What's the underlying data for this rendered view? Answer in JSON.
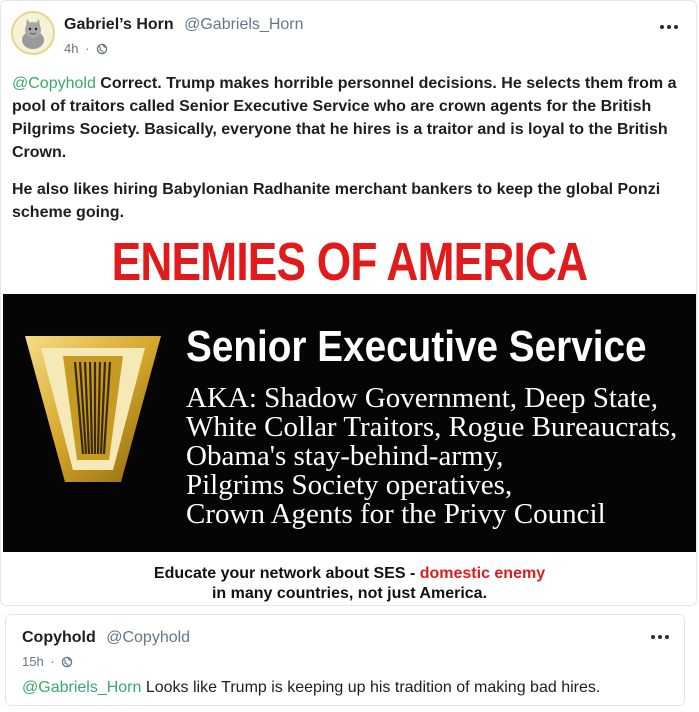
{
  "post": {
    "display_name": "Gabriel’s Horn",
    "handle": "@Gabriels_Horn",
    "time": "4h",
    "separator": "·",
    "mention": "@Copyhold",
    "paragraph1_rest": " Correct. Trump makes horrible personnel decisions. He selects them from a pool of traitors called Senior Executive Service who are crown agents for the British Pilgrims Society. Basically, everyone that he hires is a traitor and is loyal to the British Crown.",
    "paragraph2": "He also likes hiring Babylonian Radhanite merchant bankers to keep the global Ponzi scheme going.",
    "image": {
      "headline": "ENEMIES OF AMERICA",
      "title": "Senior Executive Service",
      "aka_lines": [
        "AKA: Shadow Government, Deep State,",
        "White Collar Traitors, Rogue Bureaucrats,",
        "Obama's stay-behind-army,",
        "Pilgrims Society operatives,",
        "Crown Agents for the Privy Council"
      ],
      "footer_line1_prefix": "Educate your network about SES - ",
      "footer_line1_red": "domestic enemy",
      "footer_line2": "in many countries, not just America.",
      "colors": {
        "headline": "#e11b1b",
        "band": "#050505",
        "emblem_gold": "#d4a62a"
      }
    },
    "icons": {
      "avatar": "cat-avatar-icon",
      "visibility": "globe-icon",
      "menu": "more-options-icon"
    }
  },
  "reply": {
    "display_name": "Copyhold",
    "handle": "@Copyhold",
    "time": "15h",
    "separator": "·",
    "mention": "@Gabriels_Horn",
    "text_rest": " Looks like Trump is keeping up his tradition of making bad hires."
  },
  "theme": {
    "link_color": "#3aaa6a",
    "meta_color": "#657786"
  }
}
